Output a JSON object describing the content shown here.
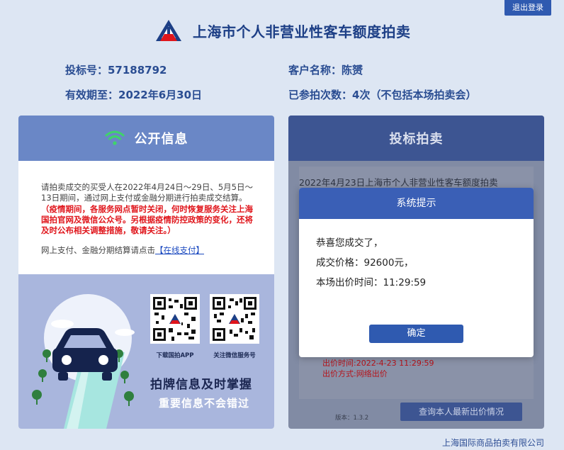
{
  "header": {
    "logout_label": "退出登录",
    "title": "上海市个人非营业性客车额度拍卖"
  },
  "bidder": {
    "bid_no": "投标号：57188792",
    "valid_until": "有效期至：2022年6月30日",
    "customer_name": "客户名称：陈赟",
    "participation": "已参拍次数：4次（不包括本场拍卖会）"
  },
  "public_info": {
    "title": "公开信息",
    "notice": "请拍卖成交的买受人在2022年4月24日～29日、5月5日～13日期间，通过网上支付或金融分期进行拍卖成交结算。",
    "red_notice": "（疫情期间，各服务网点暂时关闭，何时恢复服务关注上海国拍官网及微信公众号。另根据疫情防控政策的变化，还将及时公布相关调整措施，敬请关注。）",
    "pay_prefix": "网上支付、金融分期结算请点击",
    "pay_link": "【在线支付】",
    "qr_app_caption": "下载国拍APP",
    "qr_wechat_caption": "关注微信服务号",
    "promo_title": "拍牌信息及时掌握",
    "promo_sub": "重要信息不会错过"
  },
  "bidding": {
    "title": "投标拍卖",
    "intro_text": "2022年4月23日上海市个人非营业性客车额度拍卖",
    "bid_time": "出价时间:2022-4-23 11:29:59",
    "bid_method": "出价方式:网络出价",
    "version": "版本：1.3.2",
    "query_button": "查询本人最新出价情况"
  },
  "modal": {
    "title": "系统提示",
    "line1": "恭喜您成交了，",
    "line2": "成交价格：92600元，",
    "line3": "本场出价时间：11:29:59",
    "ok_label": "确定"
  },
  "footer": {
    "company": "上海国际商品拍卖有限公司"
  },
  "colors": {
    "background": "#dde6f3",
    "brand_blue": "#2f5ab0",
    "header_left": "#6a87c6",
    "header_right": "#3d5592",
    "alert_red": "#e0161c"
  },
  "icons": {
    "logo": "auction-logo-icon",
    "wifi": "wifi-icon",
    "car": "car-icon",
    "qr": "qr-code-icon"
  }
}
